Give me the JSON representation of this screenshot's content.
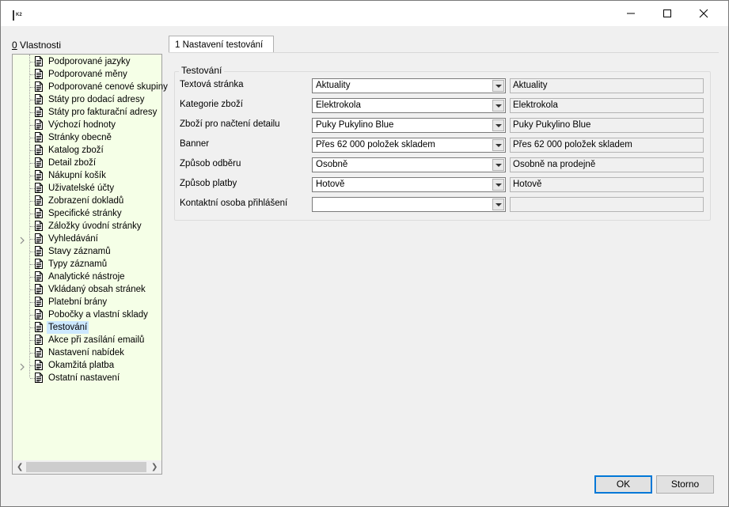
{
  "window": {
    "app_icon": "K2",
    "controls": {
      "minimize": "minimize-icon",
      "maximize": "maximize-icon",
      "close": "close-icon"
    }
  },
  "properties_label": {
    "hotkey": "0",
    "text": " Vlastnosti"
  },
  "tree": {
    "items": [
      {
        "label": "Podporované jazyky",
        "expandable": false
      },
      {
        "label": "Podporované měny",
        "expandable": false
      },
      {
        "label": "Podporované cenové skupiny",
        "expandable": false
      },
      {
        "label": "Státy pro dodací adresy",
        "expandable": false
      },
      {
        "label": "Státy pro fakturační adresy",
        "expandable": false
      },
      {
        "label": "Výchozí hodnoty",
        "expandable": false
      },
      {
        "label": "Stránky obecně",
        "expandable": false
      },
      {
        "label": "Katalog zboží",
        "expandable": false
      },
      {
        "label": "Detail zboží",
        "expandable": false
      },
      {
        "label": "Nákupní košík",
        "expandable": false
      },
      {
        "label": "Uživatelské účty",
        "expandable": false
      },
      {
        "label": "Zobrazení dokladů",
        "expandable": false
      },
      {
        "label": "Specifické stránky",
        "expandable": false
      },
      {
        "label": "Záložky úvodní stránky",
        "expandable": false
      },
      {
        "label": "Vyhledávání",
        "expandable": true
      },
      {
        "label": "Stavy záznamů",
        "expandable": false
      },
      {
        "label": "Typy záznamů",
        "expandable": false
      },
      {
        "label": "Analytické nástroje",
        "expandable": false
      },
      {
        "label": "Vkládaný obsah stránek",
        "expandable": false
      },
      {
        "label": "Platební brány",
        "expandable": false
      },
      {
        "label": "Pobočky a vlastní sklady",
        "expandable": false
      },
      {
        "label": "Testování",
        "expandable": false,
        "selected": true
      },
      {
        "label": "Akce při zasílání emailů",
        "expandable": false
      },
      {
        "label": "Nastavení nabídek",
        "expandable": false
      },
      {
        "label": "Okamžitá platba",
        "expandable": true
      },
      {
        "label": "Ostatní nastavení",
        "expandable": false
      }
    ]
  },
  "tab": {
    "label": "1 Nastavení testování"
  },
  "group": {
    "title": "Testování",
    "rows": [
      {
        "label": "Textová stránka",
        "value": "Aktuality",
        "display": "Aktuality"
      },
      {
        "label": "Kategorie zboží",
        "value": "Elektrokola",
        "display": "Elektrokola"
      },
      {
        "label": "Zboží pro načtení detailu",
        "value": "Puky Pukylino Blue",
        "display": "Puky Pukylino Blue"
      },
      {
        "label": "Banner",
        "value": "Přes 62 000 položek skladem",
        "display": "Přes 62 000 položek skladem"
      },
      {
        "label": "Způsob odběru",
        "value": "Osobně",
        "display": "Osobně na prodejně"
      },
      {
        "label": "Způsob platby",
        "value": "Hotově",
        "display": "Hotově"
      },
      {
        "label": "Kontaktní osoba přihlášení",
        "value": "",
        "display": ""
      }
    ]
  },
  "buttons": {
    "ok": "OK",
    "cancel": "Storno"
  },
  "colors": {
    "tree_background": "#f5ffe7",
    "selection": "#cce8ff",
    "default_button_border": "#0078d7"
  }
}
